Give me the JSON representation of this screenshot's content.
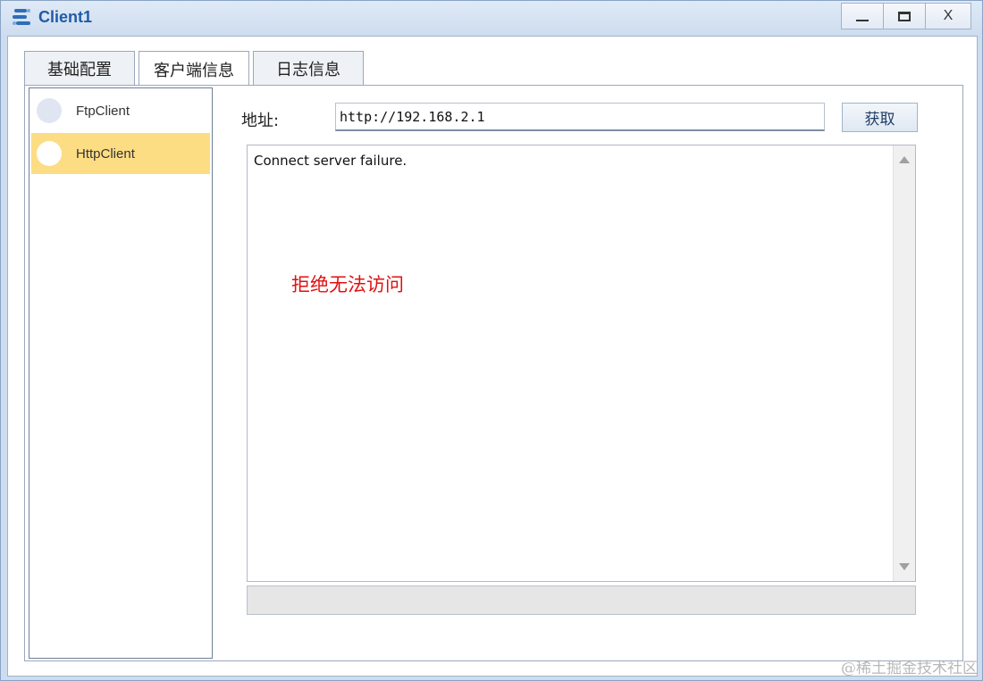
{
  "window": {
    "title": "Client1",
    "controls": {
      "minimize": "minimize-icon",
      "maximize": "maximize-icon",
      "close": "X"
    }
  },
  "tabs": [
    {
      "label": "基础配置",
      "active": false
    },
    {
      "label": "客户端信息",
      "active": true
    },
    {
      "label": "日志信息",
      "active": false
    }
  ],
  "sidebar": {
    "items": [
      {
        "label": "FtpClient",
        "selected": false
      },
      {
        "label": "HttpClient",
        "selected": true
      }
    ]
  },
  "main": {
    "address_label": "地址:",
    "address_value": "http://192.168.2.1",
    "fetch_button": "获取",
    "output_text": "Connect server failure.",
    "annotation": "拒绝无法访问"
  },
  "watermark": "@稀土掘金技术社区",
  "colors": {
    "title": "#1f5ba8",
    "selected_item": "#fddd84",
    "annotation": "#e01010"
  }
}
